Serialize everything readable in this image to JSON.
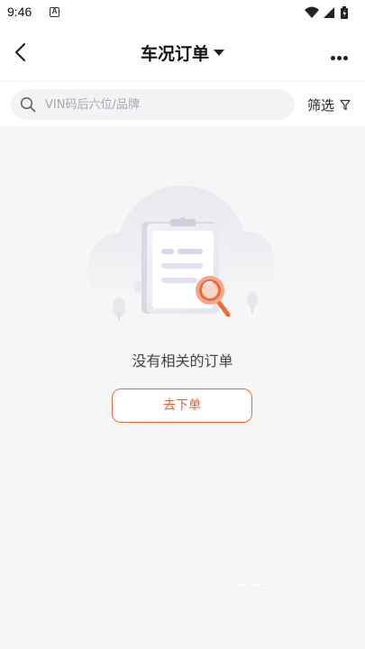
{
  "status_bar": {
    "time": "9:46",
    "notification_letter": "A",
    "icons": [
      "wifi-icon",
      "signal-icon",
      "battery-icon"
    ]
  },
  "header": {
    "title": "车况订单",
    "back_icon": "chevron-left-icon",
    "more_icon": "more-horizontal-icon",
    "title_dropdown_icon": "caret-down-icon"
  },
  "search": {
    "placeholder": "VIN码后六位/品牌",
    "value": "",
    "icon": "search-icon"
  },
  "filter": {
    "label": "筛选",
    "icon": "filter-funnel-icon"
  },
  "empty_state": {
    "illustration": "clipboard-magnifier-illustration",
    "message": "没有相关的订单",
    "action_label": "去下单"
  },
  "watermark": "天天下载站",
  "colors": {
    "accent": "#ee6a3b",
    "background": "#f6f6f6",
    "surface": "#ffffff",
    "search_bg": "#f3f3f5"
  }
}
